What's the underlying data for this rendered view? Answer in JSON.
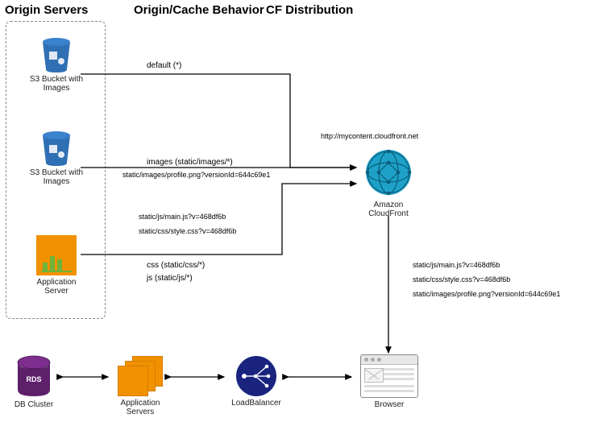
{
  "headers": {
    "col1": "Origin Servers",
    "col2": "Origin/Cache Behavior",
    "col3": "CF Distribution"
  },
  "nodes": {
    "s3a": "S3 Bucket with\nImages",
    "s3b": "S3 Bucket with\nImages",
    "appserver": "Application\nServer",
    "cloudfront": "Amazon\nCloudFront",
    "rds": "RDS",
    "rds_label": "DB Cluster",
    "appservers": "Application\nServers",
    "loadbalancer": "LoadBalancer",
    "browser": "Browser"
  },
  "edges": {
    "default": "default (*)",
    "cf_url": "http://mycontent.cloudfront.net",
    "images_behavior": "images (static/images/*)",
    "images_example": "static/images/profile.png?versionId=644c69e1",
    "js_example": "static/js/main.js?v=468df6b",
    "css_example": "static/css/style.css?v=468df6b",
    "css_behavior": "css (static/css/*)",
    "js_behavior": "js (static/js/*)",
    "dl_js": "static/js/main.js?v=468df6b",
    "dl_css": "static/css/style.css?v=468df6b",
    "dl_img": "static/images/profile.png?versionId=644c69e1"
  }
}
